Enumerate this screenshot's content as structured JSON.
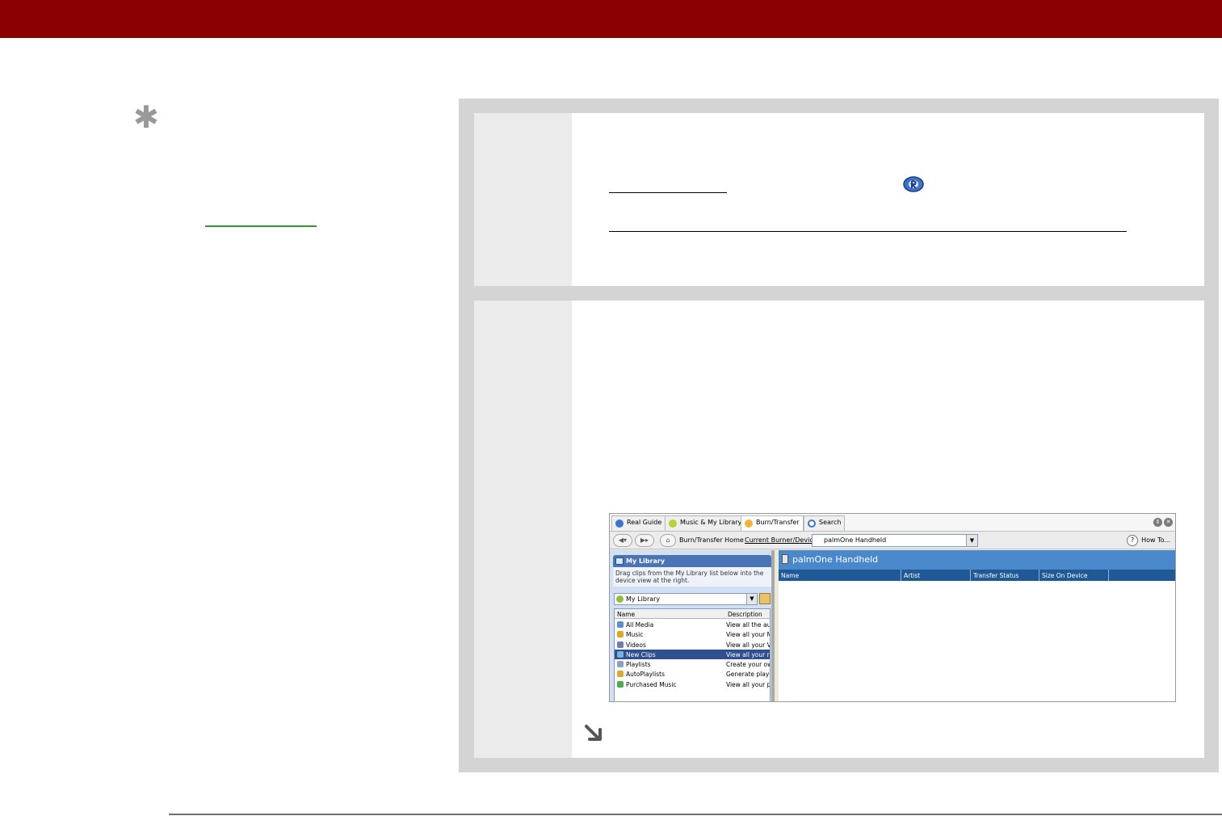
{
  "colors": {
    "header_bar": "#8b0000",
    "panel_bg": "#d4d4d4",
    "step_number_column": "#ebebeb",
    "tip_link": "#2e9e2e"
  },
  "icons": {
    "tip": "asterisk-icon",
    "player": "realplayer-icon",
    "continue": "continue-arrow-icon"
  },
  "tip": {
    "star": "✱"
  },
  "screenshot": {
    "tabs": [
      {
        "label": "Real Guide",
        "icon": "real-guide-icon"
      },
      {
        "label": "Music & My Library",
        "icon": "music-library-icon"
      },
      {
        "label": "Burn/Transfer",
        "icon": "burn-transfer-icon"
      },
      {
        "label": "Search",
        "icon": "search-icon"
      }
    ],
    "toolbar": {
      "home_label": "Burn/Transfer Home",
      "device_label": "Current Burner/Device",
      "device_value": "palmOne Handheld",
      "howto_label": "How To..."
    },
    "library": {
      "title": "My Library",
      "description": "Drag clips from the My Library list below into the device view at the right.",
      "selector_value": "My Library",
      "columns": [
        "Name",
        "Description"
      ],
      "rows": [
        {
          "name": "All Media",
          "desc": "View all the aud",
          "color": "#5b8fd0",
          "selected": false
        },
        {
          "name": "Music",
          "desc": "View all your Mu",
          "color": "#e0a62c",
          "selected": false
        },
        {
          "name": "Videos",
          "desc": "View all your Vid",
          "color": "#6d7fa8",
          "selected": false
        },
        {
          "name": "New Clips",
          "desc": "View all your re",
          "color": "#74b1e6",
          "selected": true
        },
        {
          "name": "Playlists",
          "desc": "Create your ow",
          "color": "#8aa2c2",
          "selected": false
        },
        {
          "name": "AutoPlaylists",
          "desc": "Generate playlis",
          "color": "#d9a83a",
          "selected": false
        },
        {
          "name": "Purchased Music",
          "desc": "View all your pu",
          "color": "#4fa84a",
          "selected": false
        }
      ]
    },
    "device": {
      "title": "palmOne Handheld",
      "columns": [
        "Name",
        "Artist",
        "Transfer Status",
        "Size On Device"
      ]
    }
  }
}
